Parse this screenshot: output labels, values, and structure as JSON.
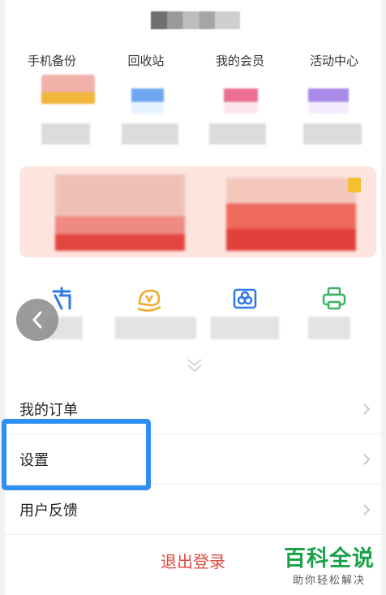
{
  "top_tools": [
    {
      "label": "手机备份",
      "accent": "#f1b63a"
    },
    {
      "label": "回收站",
      "accent": "#6fa6f2"
    },
    {
      "label": "我的会员",
      "accent": "#ec6f93"
    },
    {
      "label": "活动中心",
      "accent": "#a98ae9"
    }
  ],
  "services": [
    {
      "icon": "scan-text-icon",
      "color": "#2f78e6"
    },
    {
      "icon": "smile-vip-icon",
      "color": "#f0a92c"
    },
    {
      "icon": "photo-album-icon",
      "color": "#2f78e6"
    },
    {
      "icon": "printer-icon",
      "color": "#3ab364"
    }
  ],
  "menu": {
    "orders": "我的订单",
    "settings": "设置",
    "feedback": "用户反馈"
  },
  "logout_label": "退出登录",
  "watermark": {
    "main": "百科全说",
    "sub": "助你轻松解决"
  },
  "colors": {
    "highlight": "#2f8ef0",
    "logout": "#e04a3f",
    "watermark": "#19a24a"
  }
}
